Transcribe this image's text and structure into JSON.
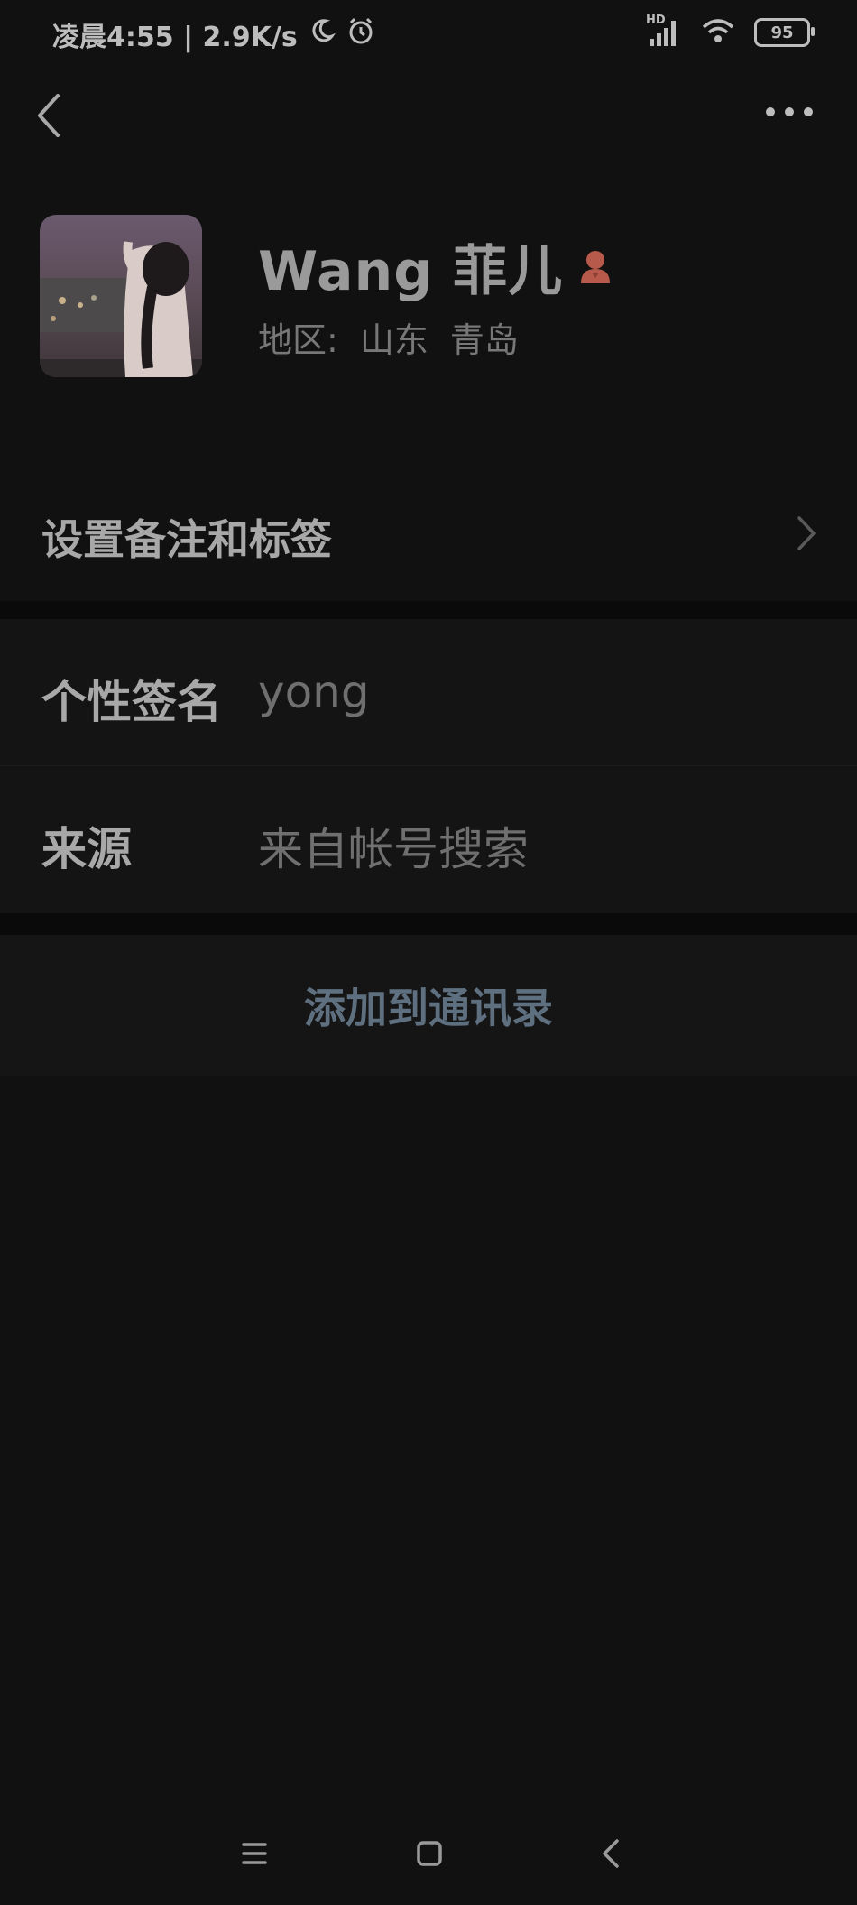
{
  "status_bar": {
    "time_text": "凌晨4:55 | 2.9K/s",
    "network_label": "HD",
    "battery_level": "95"
  },
  "profile": {
    "name": "Wang 菲儿",
    "region_label": "地区:",
    "region_province": "山东",
    "region_city": "青岛"
  },
  "rows": {
    "remark_label": "设置备注和标签",
    "signature_label": "个性签名",
    "signature_value": "yong",
    "source_label": "来源",
    "source_value": "来自帐号搜索"
  },
  "actions": {
    "add_contact_label": "添加到通讯录"
  },
  "colors": {
    "background": "#111111",
    "accent_link": "#5e7080",
    "gender_icon": "#b85a4b"
  },
  "icons": {
    "back": "chevron-left-icon",
    "more": "more-dots-icon",
    "gender": "female-icon",
    "nav_menu": "menu-icon",
    "nav_home": "home-icon",
    "nav_back": "back-icon"
  }
}
